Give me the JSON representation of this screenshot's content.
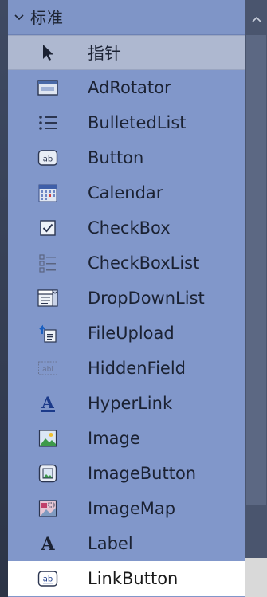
{
  "toolbox": {
    "group_title": "标准",
    "items": [
      {
        "label": "指针",
        "icon": "pointer-icon",
        "state": "selected"
      },
      {
        "label": "AdRotator",
        "icon": "adrotator-icon",
        "state": "normal"
      },
      {
        "label": "BulletedList",
        "icon": "bulleted-list-icon",
        "state": "normal"
      },
      {
        "label": "Button",
        "icon": "button-ab-icon",
        "state": "normal"
      },
      {
        "label": "Calendar",
        "icon": "calendar-icon",
        "state": "normal"
      },
      {
        "label": "CheckBox",
        "icon": "checkbox-icon",
        "state": "normal"
      },
      {
        "label": "CheckBoxList",
        "icon": "checkbox-list-icon",
        "state": "normal"
      },
      {
        "label": "DropDownList",
        "icon": "dropdown-list-icon",
        "state": "normal"
      },
      {
        "label": "FileUpload",
        "icon": "file-upload-icon",
        "state": "normal"
      },
      {
        "label": "HiddenField",
        "icon": "hidden-field-icon",
        "state": "normal"
      },
      {
        "label": "HyperLink",
        "icon": "hyperlink-icon",
        "state": "normal"
      },
      {
        "label": "Image",
        "icon": "image-icon",
        "state": "normal"
      },
      {
        "label": "ImageButton",
        "icon": "image-button-icon",
        "state": "normal"
      },
      {
        "label": "ImageMap",
        "icon": "image-map-icon",
        "state": "normal"
      },
      {
        "label": "Label",
        "icon": "label-icon",
        "state": "normal"
      },
      {
        "label": "LinkButton",
        "icon": "link-button-icon",
        "state": "highlight"
      }
    ]
  },
  "colors": {
    "panel": "#8197ca",
    "selected_row": "#aeb8d0",
    "hover_row": "#ffffff",
    "text": "#1b2233"
  }
}
